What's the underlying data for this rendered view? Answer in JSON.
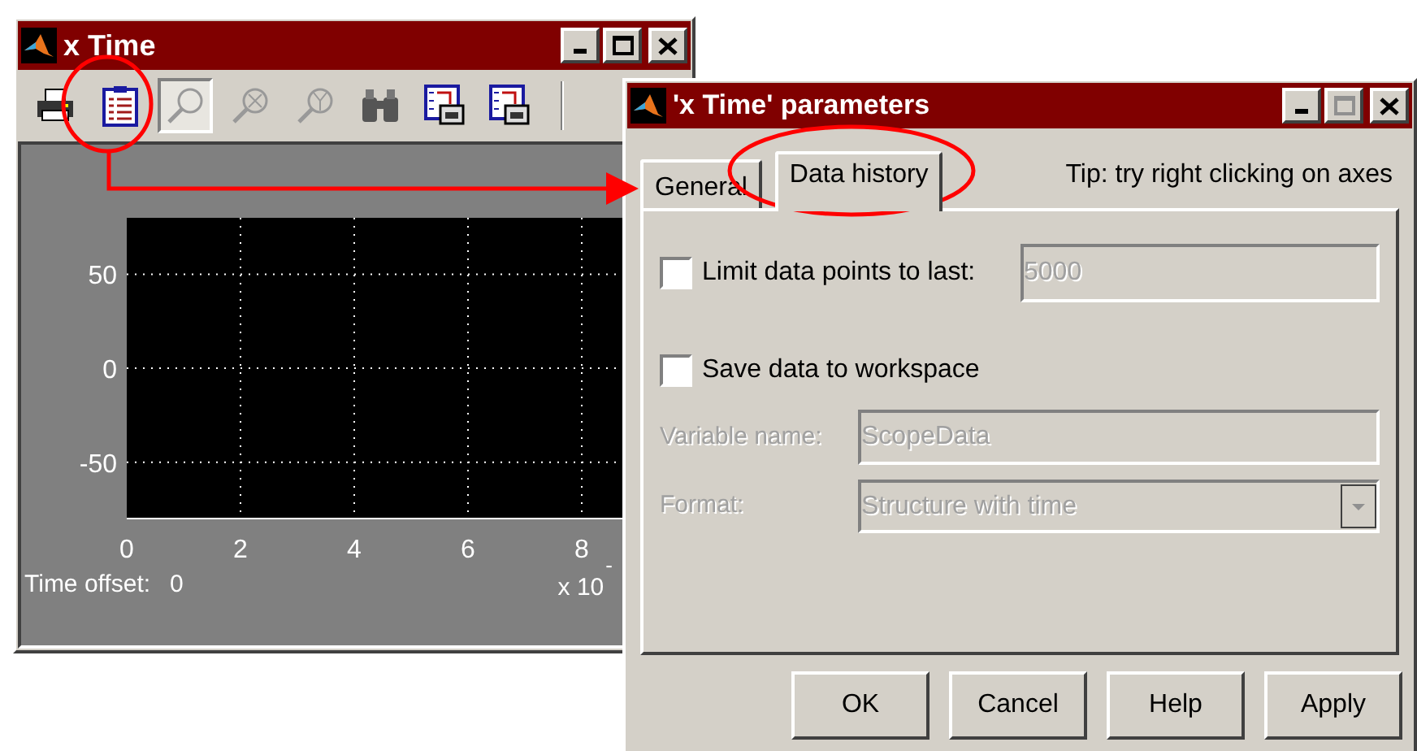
{
  "scope_window": {
    "title": "x Time",
    "toolbar": [
      {
        "kind": "print",
        "pressed": false
      },
      {
        "kind": "parameters",
        "pressed": false
      },
      {
        "kind": "zoom",
        "pressed": true
      },
      {
        "kind": "zoom-x",
        "pressed": false
      },
      {
        "kind": "zoom-y",
        "pressed": false
      },
      {
        "kind": "autoscale",
        "pressed": false
      },
      {
        "kind": "save-axes",
        "pressed": false
      },
      {
        "kind": "restore-axes",
        "pressed": false
      }
    ],
    "plot": {
      "chart_data": {
        "type": "line",
        "xlim": [
          0,
          10
        ],
        "ylim": [
          -80,
          80
        ],
        "xticks": [
          0,
          2,
          4,
          6,
          8
        ],
        "yticks": [
          -50,
          0,
          50
        ],
        "grid": true
      },
      "time_offset_label": "Time offset:",
      "time_offset_value": "0",
      "exponent_base": "x 10",
      "exponent": "-"
    }
  },
  "dialog": {
    "title": "'x Time' parameters",
    "tabs": [
      {
        "label": "General",
        "selected": false
      },
      {
        "label": "Data history",
        "selected": true
      }
    ],
    "tip": "Tip: try right clicking on axes",
    "limit_points": {
      "label": "Limit data points to last:",
      "checked": false,
      "value": "5000",
      "disabled": true
    },
    "save_to_workspace": {
      "label": "Save data to workspace",
      "checked": false
    },
    "variable_name": {
      "label": "Variable name:",
      "value": "ScopeData",
      "disabled": true
    },
    "format": {
      "label": "Format:",
      "value": "Structure with time",
      "disabled": true
    },
    "buttons": [
      "OK",
      "Cancel",
      "Help",
      "Apply"
    ]
  }
}
